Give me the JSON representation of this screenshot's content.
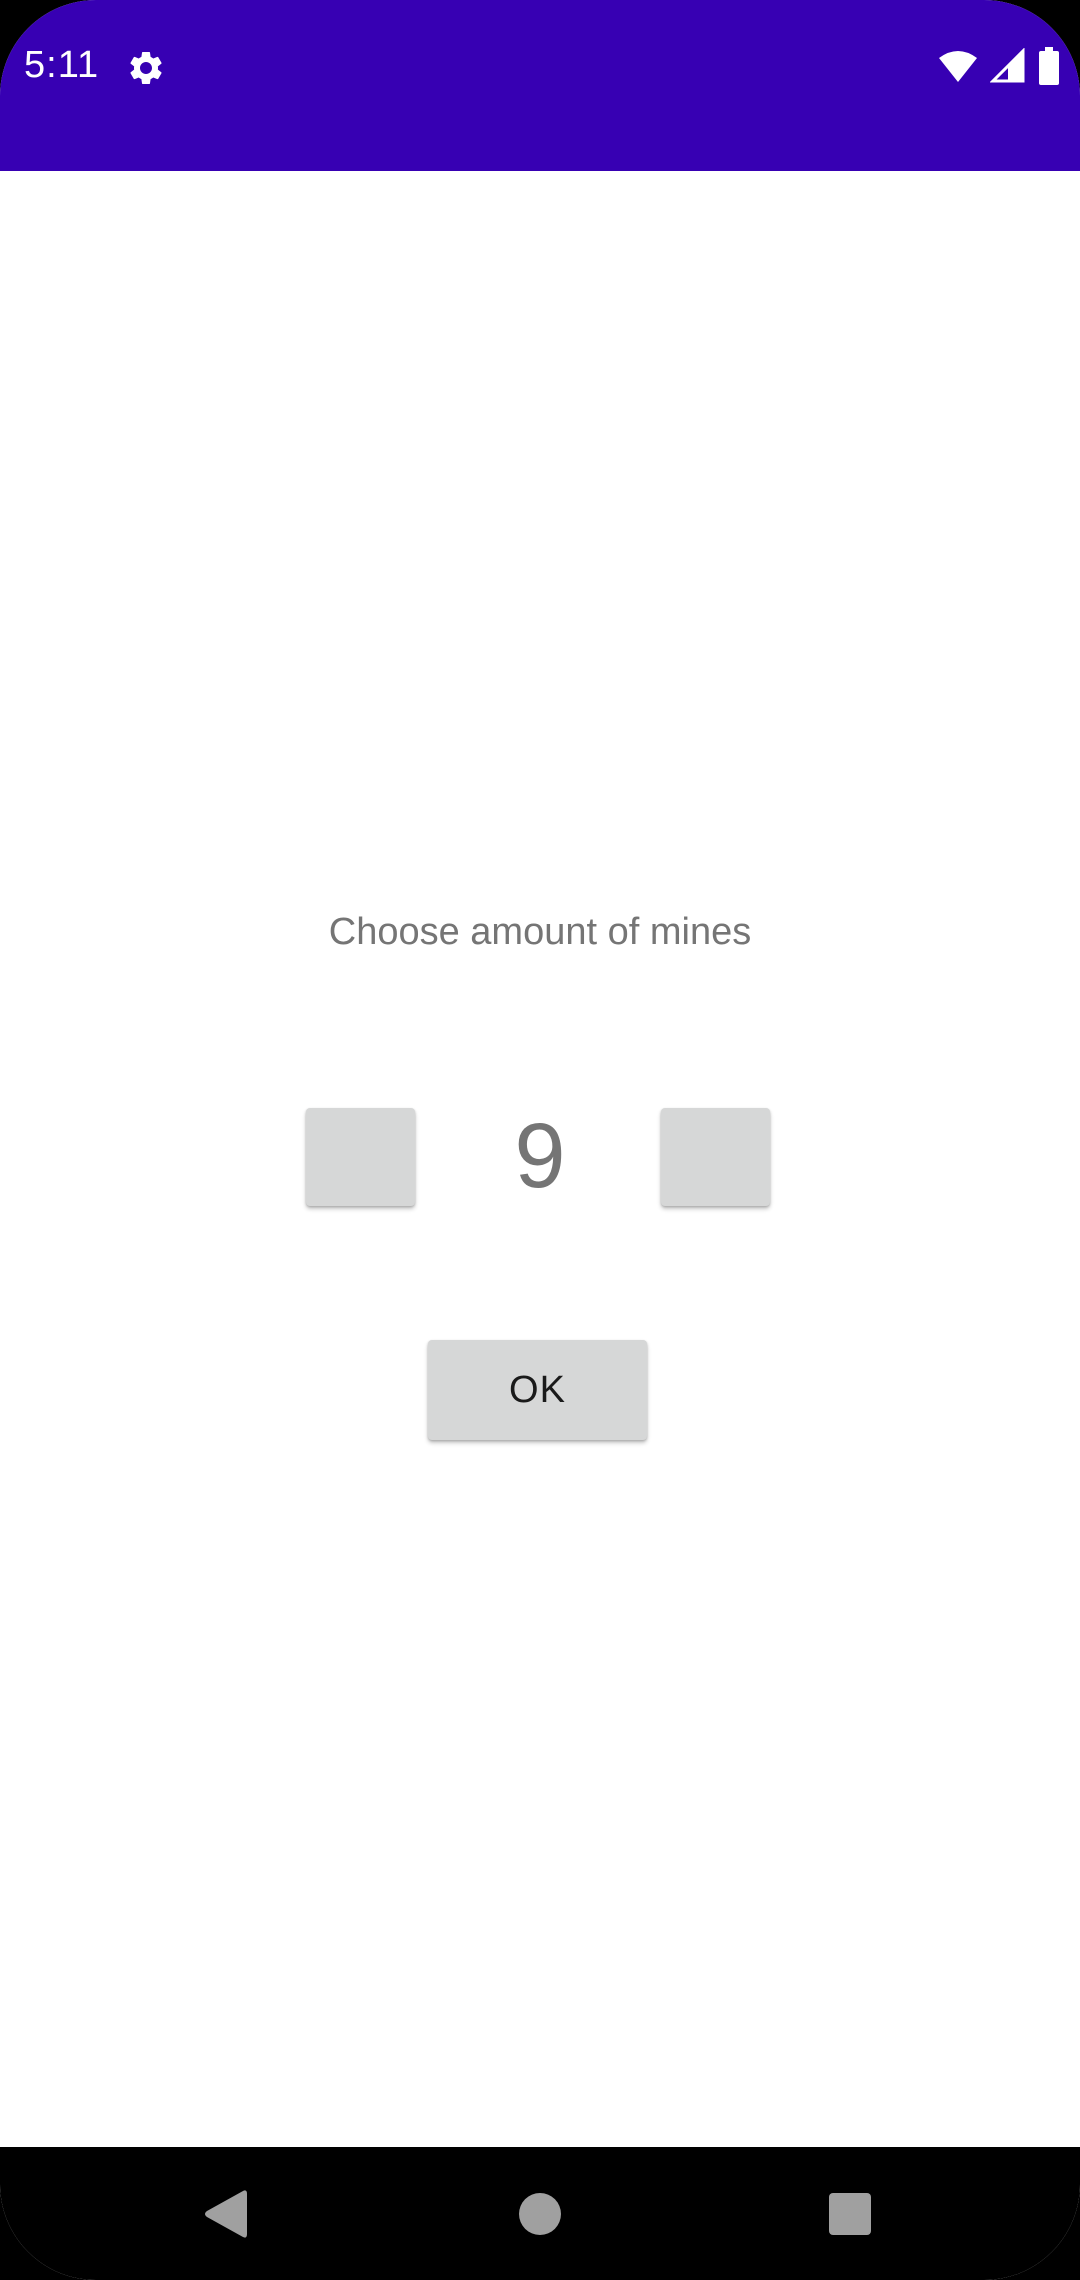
{
  "status_bar": {
    "time": "5:11",
    "background_color": "#3700b3",
    "icons": [
      "settings-gear-icon",
      "wifi-icon",
      "cellular-signal-icon",
      "battery-icon"
    ]
  },
  "main": {
    "prompt": "Choose amount of mines",
    "mine_count": "9",
    "decrement_button_label": "",
    "increment_button_label": "",
    "ok_label": "OK"
  },
  "nav_bar": {
    "buttons": [
      "back-icon",
      "home-icon",
      "recents-icon"
    ]
  },
  "colors": {
    "accent": "#3700b3",
    "button_bg": "#d6d7d7",
    "text_secondary": "#757575"
  }
}
